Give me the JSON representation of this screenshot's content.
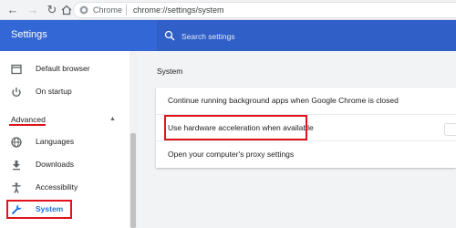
{
  "browser": {
    "omnibox_origin": "Chrome",
    "omnibox_url": "chrome://settings/system"
  },
  "header": {
    "title": "Settings",
    "search_placeholder": "Search settings"
  },
  "sidebar": {
    "items": [
      {
        "label": "Default browser",
        "icon": "browser-icon"
      },
      {
        "label": "On startup",
        "icon": "power-icon"
      }
    ],
    "section": "Advanced",
    "advanced_items": [
      {
        "label": "Languages",
        "icon": "globe-icon"
      },
      {
        "label": "Downloads",
        "icon": "download-icon"
      },
      {
        "label": "Accessibility",
        "icon": "accessibility-icon"
      },
      {
        "label": "System",
        "icon": "wrench-icon"
      }
    ]
  },
  "main": {
    "section_title": "System",
    "rows": [
      {
        "label": "Continue running background apps when Google Chrome is closed"
      },
      {
        "label": "Use hardware acceleration when available"
      },
      {
        "label": "Open your computer's proxy settings"
      }
    ]
  },
  "colors": {
    "header_blue": "#3367d6",
    "highlight_red": "#e0121b",
    "system_blue": "#1a73e8"
  }
}
